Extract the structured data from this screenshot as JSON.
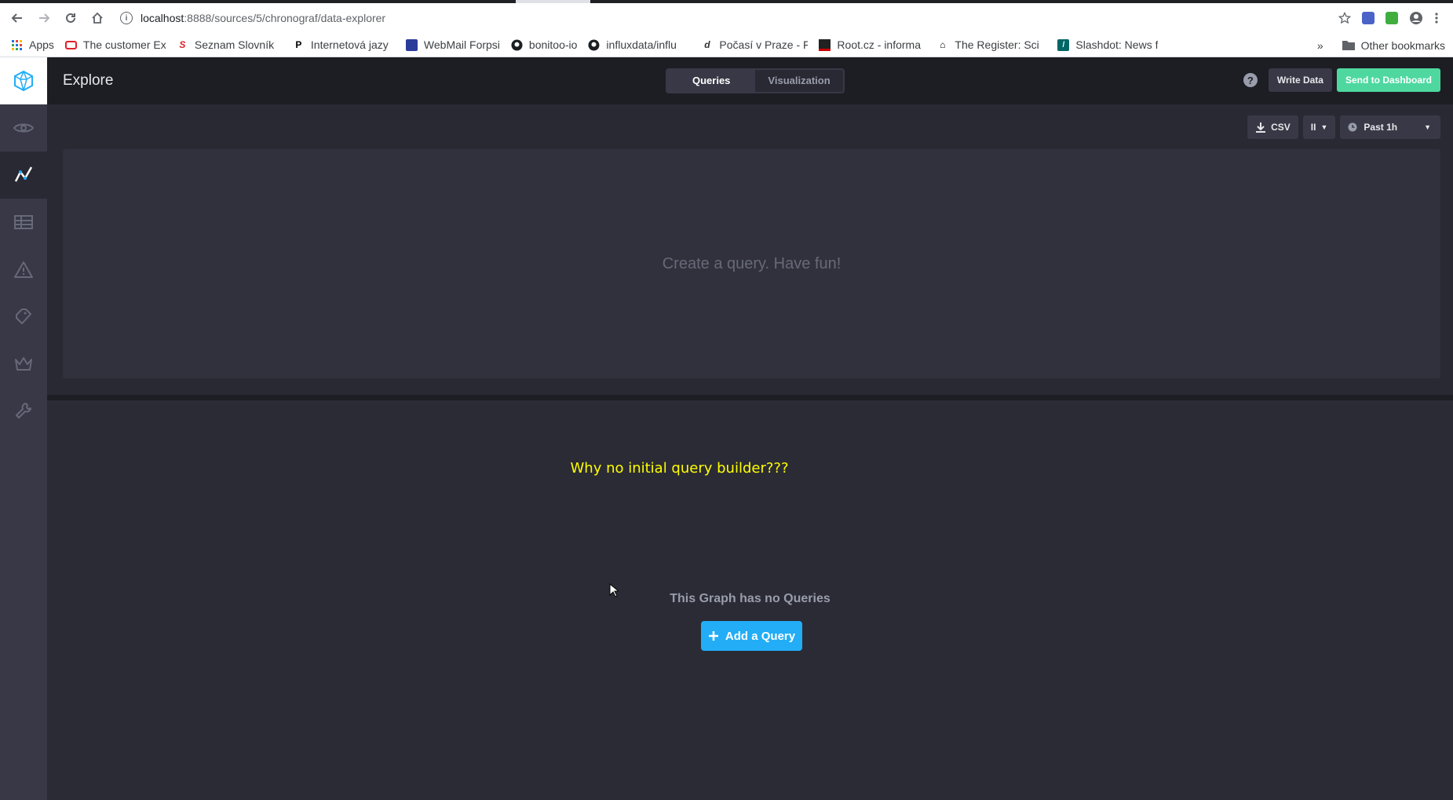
{
  "browser": {
    "url_host": "localhost",
    "url_path": ":8888/sources/5/chronograf/data-explorer",
    "bookmarks": [
      {
        "label": "Apps",
        "icon": "apps-grid-icon"
      },
      {
        "label": "The customer Ex",
        "icon": "oracle-icon",
        "color": "#e0202a"
      },
      {
        "label": "Seznam Slovník",
        "icon": "seznam-icon",
        "color": "#d8222a"
      },
      {
        "label": "Internetová jazy",
        "icon": "p-icon",
        "color": "#000000"
      },
      {
        "label": "WebMail Forpsi",
        "icon": "forpsi-icon",
        "color": "#2a3c99"
      },
      {
        "label": "bonitoo-io",
        "icon": "github-icon",
        "color": "#000000"
      },
      {
        "label": "influxdata/influ",
        "icon": "github-icon",
        "color": "#000000"
      },
      {
        "label": "Počasí v Praze - F",
        "icon": "weather-icon",
        "color": "#333333"
      },
      {
        "label": "Root.cz - informa",
        "icon": "root-icon",
        "color": "#cc0000"
      },
      {
        "label": "The Register: Sci",
        "icon": "register-icon",
        "color": "#000000"
      },
      {
        "label": "Slashdot: News f",
        "icon": "slashdot-icon",
        "color": "#006666"
      }
    ],
    "more": "»",
    "other_bookmarks": "Other bookmarks"
  },
  "header": {
    "title": "Explore",
    "tabs": [
      {
        "label": "Queries",
        "active": true
      },
      {
        "label": "Visualization",
        "active": false
      }
    ],
    "help": "?",
    "write_data": "Write Data",
    "send_to_dashboard": "Send to Dashboard"
  },
  "graph": {
    "csv_label": "CSV",
    "pause_label": "II",
    "time_range": "Past 1h",
    "empty_message": "Create a query. Have fun!"
  },
  "query": {
    "annotation": "Why no initial query builder???",
    "no_queries": "This Graph has no Queries",
    "add_query": "Add a Query"
  },
  "colors": {
    "accent_green": "#4ed8a0",
    "accent_blue": "#22adf6",
    "annotation_yellow": "#ffff00"
  }
}
